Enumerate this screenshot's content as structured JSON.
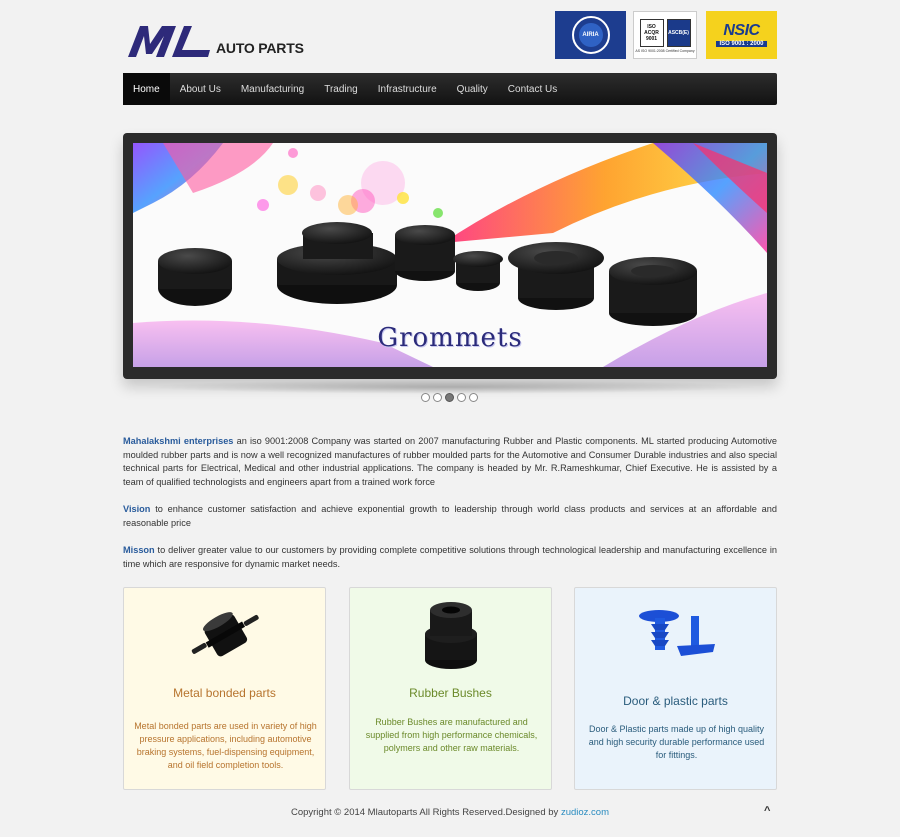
{
  "header": {
    "logo_text": "AUTO PARTS",
    "badges": {
      "airia": "AIRIA",
      "iso_left": "ISO ACQR 9001",
      "iso_right": "ASCB(E)",
      "iso_caption": "AS ISO 9001:2008 Certified Company",
      "nsic": "NSIC",
      "nsic_sub": "ISO 9001 : 2000"
    }
  },
  "nav": {
    "items": [
      {
        "label": "Home"
      },
      {
        "label": "About Us"
      },
      {
        "label": "Manufacturing"
      },
      {
        "label": "Trading"
      },
      {
        "label": "Infrastructure"
      },
      {
        "label": "Quality"
      },
      {
        "label": "Contact Us"
      }
    ]
  },
  "slider": {
    "caption": "Grommets",
    "active_index": 2,
    "dot_count": 5
  },
  "intro": {
    "company": "Mahalakshmi enterprises",
    "company_text": " an iso 9001:2008 Company was started on 2007 manufacturing Rubber and Plastic components. ML started producing Automotive moulded rubber parts and is now a well recognized manufactures of rubber moulded parts for the Automotive and Consumer Durable industries and also special technical parts for Electrical, Medical and other industrial applications. The company is headed by Mr. R.Rameshkumar, Chief Executive. He is assisted by a team of qualified technologists and engineers apart from a trained work force",
    "vision_label": "Vision",
    "vision_text": " to enhance customer satisfaction and achieve exponential growth to leadership through world class products and services at an affordable and reasonable price",
    "mission_label": "Misson",
    "mission_text": " to deliver greater value to our customers by providing complete competitive solutions through technological leadership and manufacturing excellence in time which are responsive for dynamic market needs."
  },
  "cards": [
    {
      "title": "Metal bonded parts",
      "text": "Metal bonded parts are used in variety of high pressure applications, including automotive braking systems, fuel-dispensing equipment, and oil field completion tools."
    },
    {
      "title": "Rubber Bushes",
      "text": "Rubber Bushes are manufactured and supplied from high performance chemicals, polymers and other raw materials."
    },
    {
      "title": "Door & plastic parts",
      "text": "Door & Plastic parts made up of high quality and high security durable performance used for fittings."
    }
  ],
  "footer": {
    "text": "Copyright © 2014 Mlautoparts All Rights Reserved.Designed by ",
    "link": "zudioz.com",
    "to_top": "^"
  },
  "colors": {
    "brand": "#2e2a7a",
    "nav_bg": "#1a1a1a",
    "link": "#2a5c9c"
  }
}
